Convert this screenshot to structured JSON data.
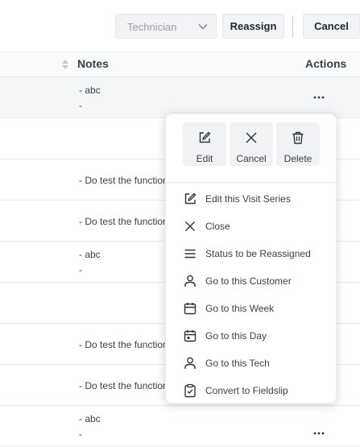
{
  "toolbar": {
    "technician_select": "Technician",
    "reassign_label": "Reassign",
    "cancel_label": "Cancel"
  },
  "table": {
    "headers": {
      "notes": "Notes",
      "actions": "Actions"
    },
    "rows": [
      {
        "note_line1": "- abc",
        "note_line2": "-",
        "actions": "..."
      },
      {
        "note_line1": "",
        "note_line2": "",
        "actions": ""
      },
      {
        "note_line1": "- Do test the function",
        "note_line2": "",
        "actions": ""
      },
      {
        "note_line1": "- Do test the function",
        "note_line2": "",
        "actions": ""
      },
      {
        "note_line1": "- abc",
        "note_line2": "-",
        "actions": ""
      },
      {
        "note_line1": "",
        "note_line2": "",
        "actions": ""
      },
      {
        "note_line1": "- Do test the function",
        "note_line2": "",
        "actions": ""
      },
      {
        "note_line1": "- Do test the function",
        "note_line2": "",
        "actions": ""
      },
      {
        "note_line1": "- abc",
        "note_line2": "-",
        "actions": "..."
      }
    ]
  },
  "context_menu": {
    "quick_actions": [
      {
        "label": "Edit",
        "icon": "edit-icon"
      },
      {
        "label": "Cancel",
        "icon": "close-icon"
      },
      {
        "label": "Delete",
        "icon": "trash-icon"
      }
    ],
    "items": [
      {
        "label": "Edit this Visit Series",
        "icon": "edit-icon"
      },
      {
        "label": "Close",
        "icon": "close-icon"
      },
      {
        "label": "Status to be Reassigned",
        "icon": "list-icon"
      },
      {
        "label": "Go to this Customer",
        "icon": "person-icon"
      },
      {
        "label": "Go to this Week",
        "icon": "calendar-icon"
      },
      {
        "label": "Go to this Day",
        "icon": "calendar-day-icon"
      },
      {
        "label": "Go to this Tech",
        "icon": "person-icon"
      },
      {
        "label": "Convert to Fieldslip",
        "icon": "clipboard-check-icon"
      }
    ]
  },
  "colors": {
    "text": "#2c3440",
    "button_bg": "#f2f3f5",
    "row_highlight": "#f4f5f6",
    "border": "#e6e8eb"
  }
}
